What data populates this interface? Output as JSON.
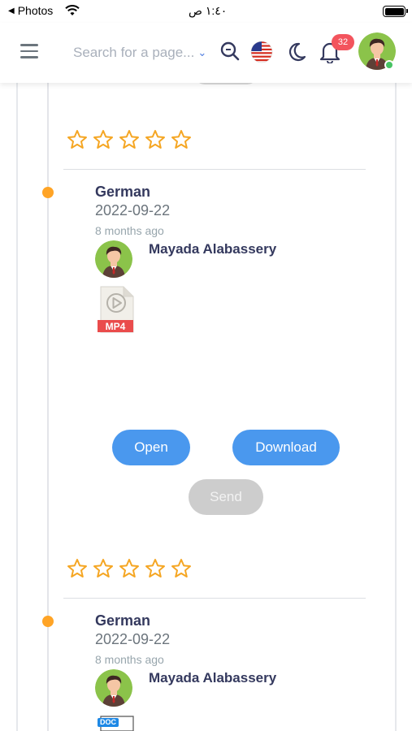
{
  "status_bar": {
    "back_label": "Photos",
    "time": "١:٤٠ ص"
  },
  "navbar": {
    "search_placeholder": "Search for a page...",
    "notification_count": "32"
  },
  "ratings": [
    {
      "stars": 0,
      "max": 5
    },
    {
      "stars": 0,
      "max": 5
    }
  ],
  "entries": [
    {
      "language": "German",
      "date": "2022-09-22",
      "ago": "8 months ago",
      "author": "Mayada Alabassery",
      "file_type": "MP4",
      "buttons": {
        "open": "Open",
        "download": "Download",
        "send": "Send"
      }
    },
    {
      "language": "German",
      "date": "2022-09-22",
      "ago": "8 months ago",
      "author": "Mayada Alabassery",
      "file_type": "DOC"
    }
  ],
  "colors": {
    "accent": "#4a98ee",
    "star": "#f5a623",
    "dot": "#ffa426",
    "badge": "#f3545d",
    "online": "#47c363"
  }
}
